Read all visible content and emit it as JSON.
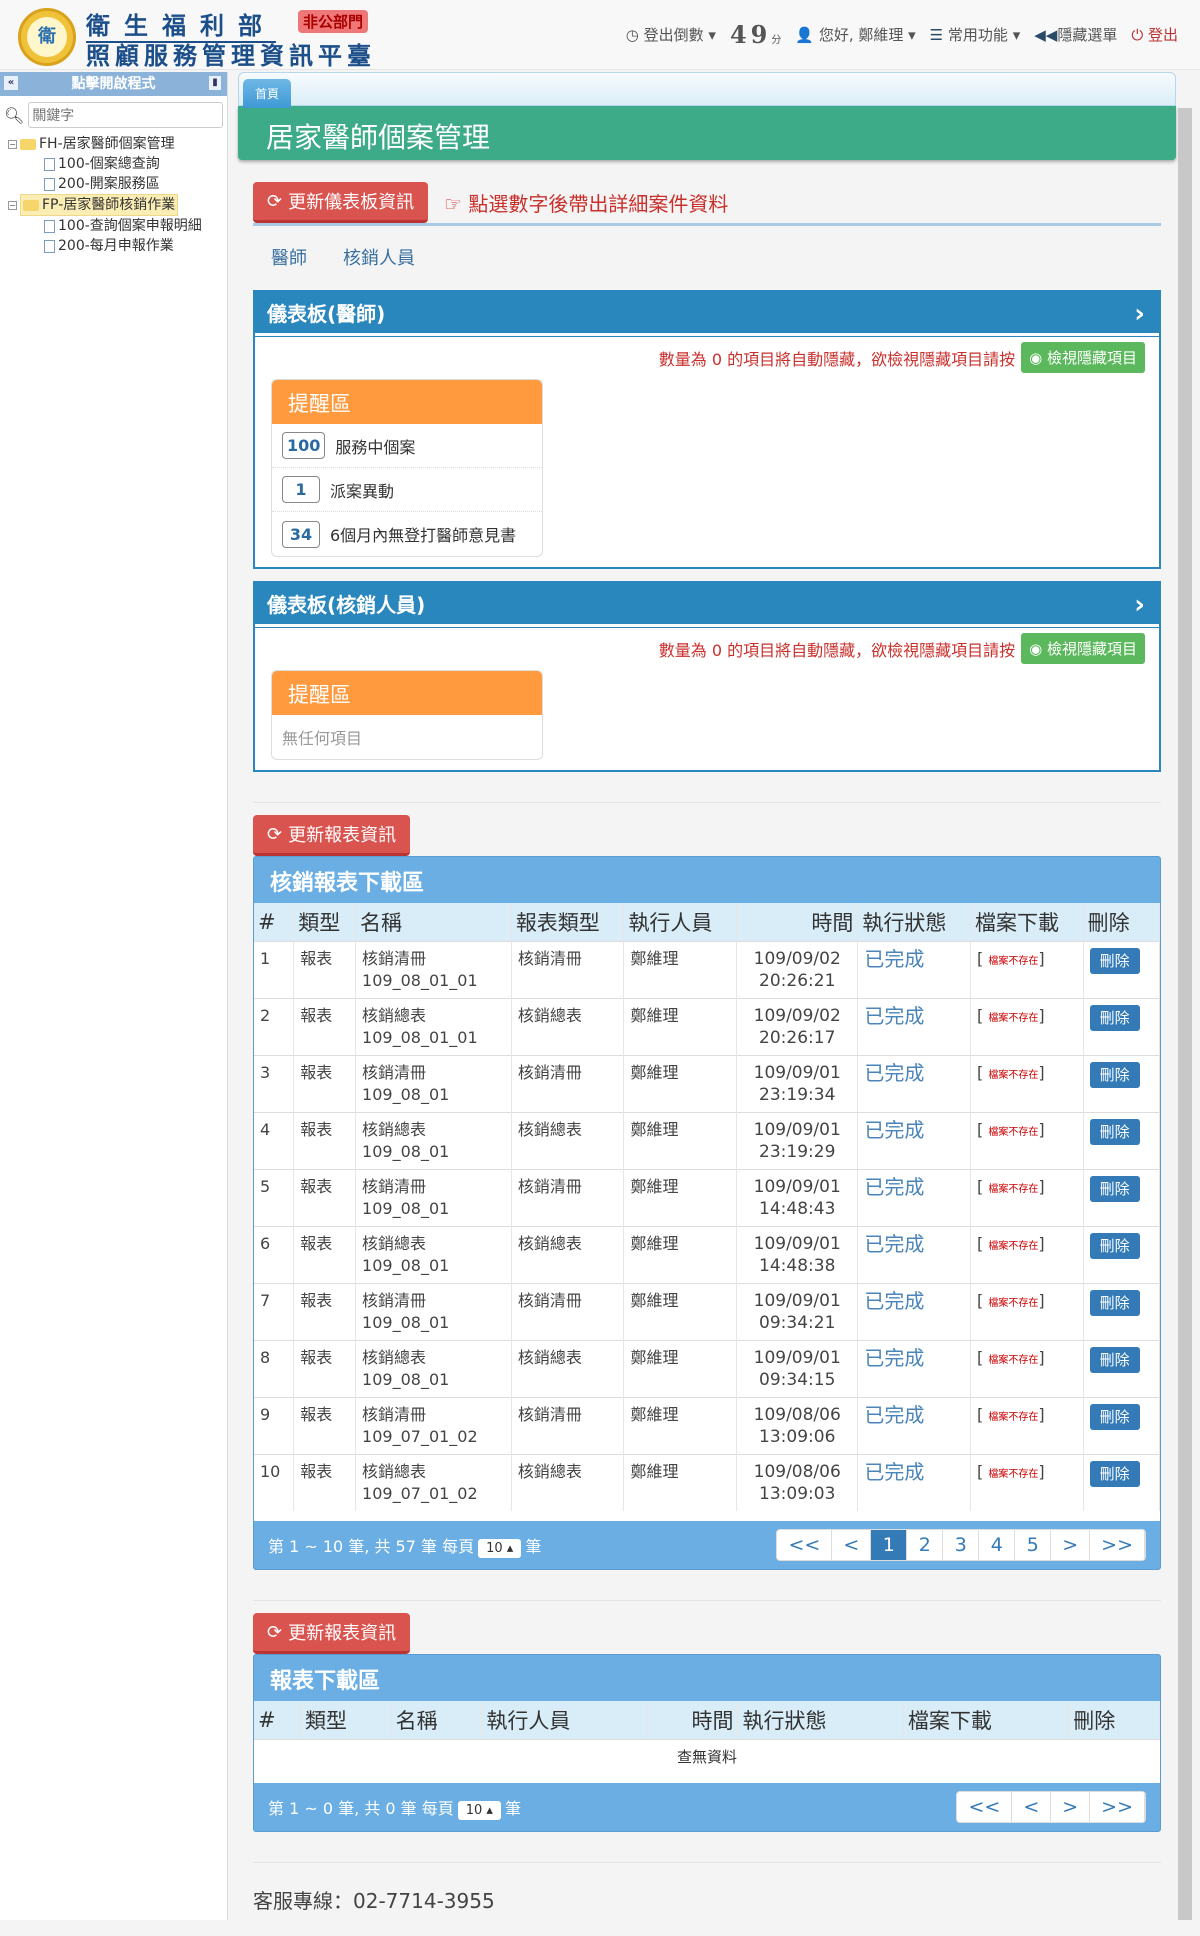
{
  "header": {
    "ministry": "衛生福利部",
    "badge": "非公部門",
    "platform": "照顧服務管理資訊平臺",
    "logo_text": "衛",
    "countdown_label": "登出倒數",
    "countdown_value": "49",
    "countdown_unit": "分",
    "greeting": "您好, 鄭維理",
    "common": "常用功能",
    "hide_menu": "隱藏選單",
    "logout": "登出"
  },
  "sidebar": {
    "title": "點擊開啟程式",
    "search_placeholder": "關鍵字",
    "tree": [
      {
        "label": "FH-居家醫師個案管理",
        "children": [
          "100-個案總查詢",
          "200-開案服務區"
        ]
      },
      {
        "label": "FP-居家醫師核銷作業",
        "children": [
          "100-查詢個案申報明細",
          "200-每月申報作業"
        ]
      }
    ]
  },
  "tabs": {
    "home": "首頁"
  },
  "page": {
    "title": "居家醫師個案管理",
    "refresh_dashboard": "更新儀表板資訊",
    "tip": "點選數字後帶出詳細案件資料",
    "subtabs": [
      "醫師",
      "核銷人員"
    ]
  },
  "dash1": {
    "title": "儀表板(醫師)",
    "notice": "數量為 0 的項目將自動隱藏，欲檢視隱藏項目請按",
    "show_hidden": "檢視隱藏項目",
    "remind_title": "提醒區",
    "items": [
      {
        "count": "100",
        "label": "服務中個案"
      },
      {
        "count": "1",
        "label": "派案異動"
      },
      {
        "count": "34",
        "label": "6個月內無登打醫師意見書"
      }
    ]
  },
  "dash2": {
    "title": "儀表板(核銷人員)",
    "notice": "數量為 0 的項目將自動隱藏，欲檢視隱藏項目請按",
    "show_hidden": "檢視隱藏項目",
    "remind_title": "提醒區",
    "empty": "無任何項目"
  },
  "report1": {
    "refresh": "更新報表資訊",
    "title": "核銷報表下載區",
    "columns": [
      "#",
      "類型",
      "名稱",
      "報表類型",
      "執行人員",
      "時間",
      "執行狀態",
      "檔案下載",
      "刪除"
    ],
    "rows": [
      [
        "1",
        "報表",
        "核銷清冊",
        "109_08_01_01",
        "核銷清冊",
        "鄭維理",
        "109/09/02",
        "20:26:21",
        "已完成",
        "檔案不存在",
        "刪除"
      ],
      [
        "2",
        "報表",
        "核銷總表",
        "109_08_01_01",
        "核銷總表",
        "鄭維理",
        "109/09/02",
        "20:26:17",
        "已完成",
        "檔案不存在",
        "刪除"
      ],
      [
        "3",
        "報表",
        "核銷清冊",
        "109_08_01",
        "核銷清冊",
        "鄭維理",
        "109/09/01",
        "23:19:34",
        "已完成",
        "檔案不存在",
        "刪除"
      ],
      [
        "4",
        "報表",
        "核銷總表",
        "109_08_01",
        "核銷總表",
        "鄭維理",
        "109/09/01",
        "23:19:29",
        "已完成",
        "檔案不存在",
        "刪除"
      ],
      [
        "5",
        "報表",
        "核銷清冊",
        "109_08_01",
        "核銷清冊",
        "鄭維理",
        "109/09/01",
        "14:48:43",
        "已完成",
        "檔案不存在",
        "刪除"
      ],
      [
        "6",
        "報表",
        "核銷總表",
        "109_08_01",
        "核銷總表",
        "鄭維理",
        "109/09/01",
        "14:48:38",
        "已完成",
        "檔案不存在",
        "刪除"
      ],
      [
        "7",
        "報表",
        "核銷清冊",
        "109_08_01",
        "核銷清冊",
        "鄭維理",
        "109/09/01",
        "09:34:21",
        "已完成",
        "檔案不存在",
        "刪除"
      ],
      [
        "8",
        "報表",
        "核銷總表",
        "109_08_01",
        "核銷總表",
        "鄭維理",
        "109/09/01",
        "09:34:15",
        "已完成",
        "檔案不存在",
        "刪除"
      ],
      [
        "9",
        "報表",
        "核銷清冊",
        "109_07_01_02",
        "核銷清冊",
        "鄭維理",
        "109/08/06",
        "13:09:06",
        "已完成",
        "檔案不存在",
        "刪除"
      ],
      [
        "10",
        "報表",
        "核銷總表",
        "109_07_01_02",
        "核銷總表",
        "鄭維理",
        "109/08/06",
        "13:09:03",
        "已完成",
        "檔案不存在",
        "刪除"
      ]
    ],
    "summary": "第 1 ~ 10 筆, 共 57 筆 每頁",
    "per_page": "10",
    "unit": "筆",
    "pages": [
      "<<",
      "<",
      "1",
      "2",
      "3",
      "4",
      "5",
      ">",
      ">>"
    ]
  },
  "report2": {
    "refresh": "更新報表資訊",
    "title": "報表下載區",
    "columns": [
      "#",
      "類型",
      "名稱",
      "執行人員",
      "時間",
      "執行狀態",
      "檔案下載",
      "刪除"
    ],
    "nodata": "查無資料",
    "summary": "第 1 ~ 0 筆, 共 0 筆 每頁",
    "per_page": "10",
    "unit": "筆",
    "pages": [
      "<<",
      "<",
      ">",
      ">>"
    ]
  },
  "footer": {
    "hotline": "客服專線：02-7714-3955"
  }
}
